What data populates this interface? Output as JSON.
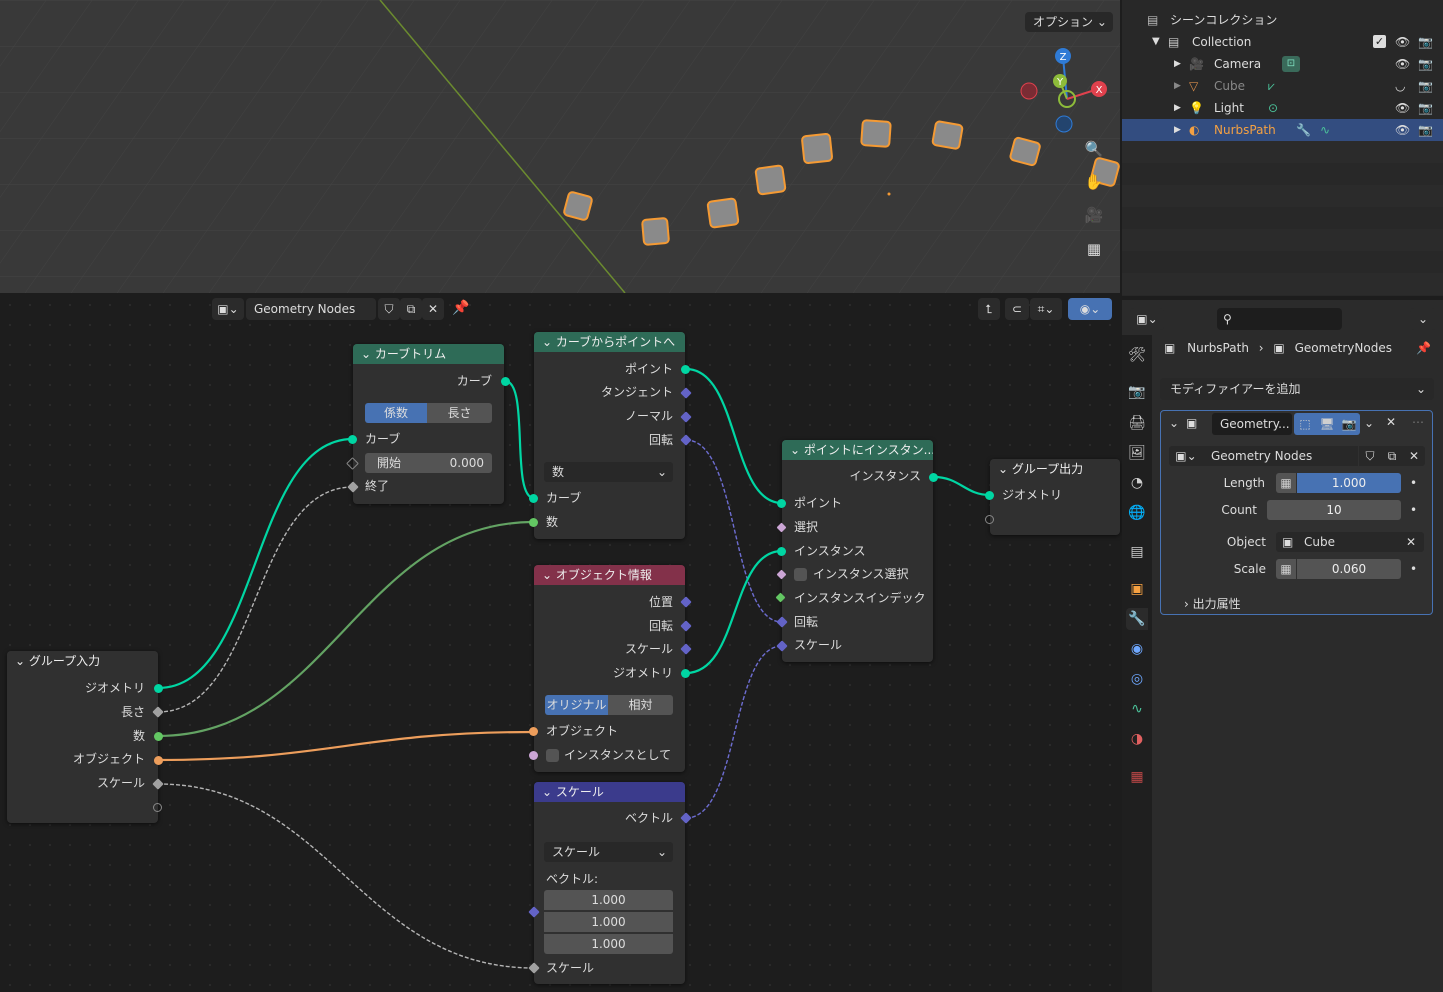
{
  "viewport": {
    "options_label": "オプション",
    "axes": {
      "z": "Z",
      "y": "Y",
      "x": "X"
    }
  },
  "node_editor": {
    "tree_name": "Geometry Nodes",
    "nodes": {
      "curve_trim": {
        "title": "カーブトリム",
        "out_curve": "カーブ",
        "mode_factor": "係数",
        "mode_length": "長さ",
        "in_curve": "カーブ",
        "start_label": "開始",
        "start_value": "0.000",
        "end_label": "終了"
      },
      "curve_to_points": {
        "title": "カーブからポイントへ",
        "out_points": "ポイント",
        "out_tangent": "タンジェント",
        "out_normal": "ノーマル",
        "out_rotation": "回転",
        "mode": "数",
        "in_curve": "カーブ",
        "in_count": "数"
      },
      "instance_on_points": {
        "title": "ポイントにインスタン...",
        "out_instances": "インスタンス",
        "in_points": "ポイント",
        "in_selection": "選択",
        "in_instance": "インスタンス",
        "in_pick_instance": "インスタンス選択",
        "in_instance_index": "インスタンスインデック",
        "in_rotation": "回転",
        "in_scale": "スケール"
      },
      "group_output": {
        "title": "グループ出力",
        "in_geometry": "ジオメトリ"
      },
      "object_info": {
        "title": "オブジェクト情報",
        "out_location": "位置",
        "out_rotation": "回転",
        "out_scale": "スケール",
        "out_geometry": "ジオメトリ",
        "mode_original": "オリジナル",
        "mode_relative": "相対",
        "in_object": "オブジェクト",
        "in_as_instance": "インスタンスとして"
      },
      "group_input": {
        "title": "グループ入力",
        "out_geometry": "ジオメトリ",
        "out_length": "長さ",
        "out_count": "数",
        "out_object": "オブジェクト",
        "out_scale": "スケール"
      },
      "scale": {
        "title": "スケール",
        "out_vector": "ベクトル",
        "operation": "スケール",
        "vector_label": "ベクトル:",
        "vector": [
          "1.000",
          "1.000",
          "1.000"
        ],
        "in_scale": "スケール"
      }
    }
  },
  "outliner": {
    "scene_collection": "シーンコレクション",
    "items": [
      {
        "name": "Collection"
      },
      {
        "name": "Camera"
      },
      {
        "name": "Cube"
      },
      {
        "name": "Light"
      },
      {
        "name": "NurbsPath"
      }
    ]
  },
  "properties": {
    "breadcrumb_object": "NurbsPath",
    "breadcrumb_modifier": "GeometryNodes",
    "add_modifier": "モディファイアーを追加",
    "modifier_name": "Geometry...",
    "node_group": "Geometry Nodes",
    "fields": {
      "length_label": "Length",
      "length_value": "1.000",
      "count_label": "Count",
      "count_value": "10",
      "object_label": "Object",
      "object_value": "Cube",
      "scale_label": "Scale",
      "scale_value": "0.060"
    },
    "output_attributes": "出力属性"
  },
  "colors": {
    "accent_blue": "#4772b3",
    "selected_orange": "#f49a34",
    "node_green_header": "#2e6b57",
    "node_red_header": "#83314a",
    "node_blue_header": "#3b3b8c"
  }
}
